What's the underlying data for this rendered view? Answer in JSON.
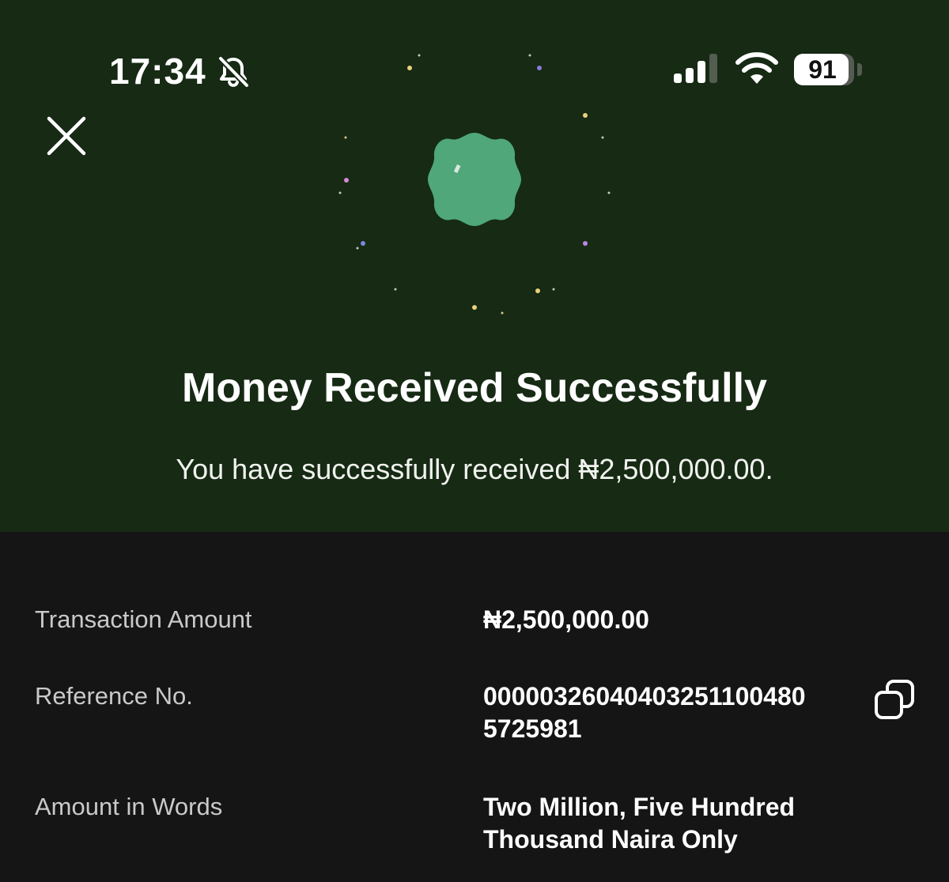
{
  "status_bar": {
    "time": "17:34",
    "battery_level": "91",
    "icons": [
      "bell-muted-icon",
      "cellular-signal-icon",
      "wifi-icon",
      "battery-icon"
    ]
  },
  "header": {
    "close_icon": "close-icon",
    "badge_icon": "success-badge-icon",
    "title": "Money Received Successfully",
    "subtitle": "You have successfully received ₦2,500,000.00."
  },
  "details": {
    "rows": [
      {
        "label": "Transaction Amount",
        "value": "₦2,500,000.00"
      },
      {
        "label": "Reference No.",
        "value": "00000326040403251100480\n5725981",
        "action_icon": "copy-icon"
      },
      {
        "label": "Amount in Words",
        "value": "Two Million, Five Hundred\nThousand  Naira Only"
      }
    ]
  },
  "colors": {
    "hero_background": "#162a14",
    "details_background": "#151515",
    "badge_green": "#4fa77a",
    "text_primary": "#ffffff",
    "text_secondary": "#c9c9c9"
  }
}
